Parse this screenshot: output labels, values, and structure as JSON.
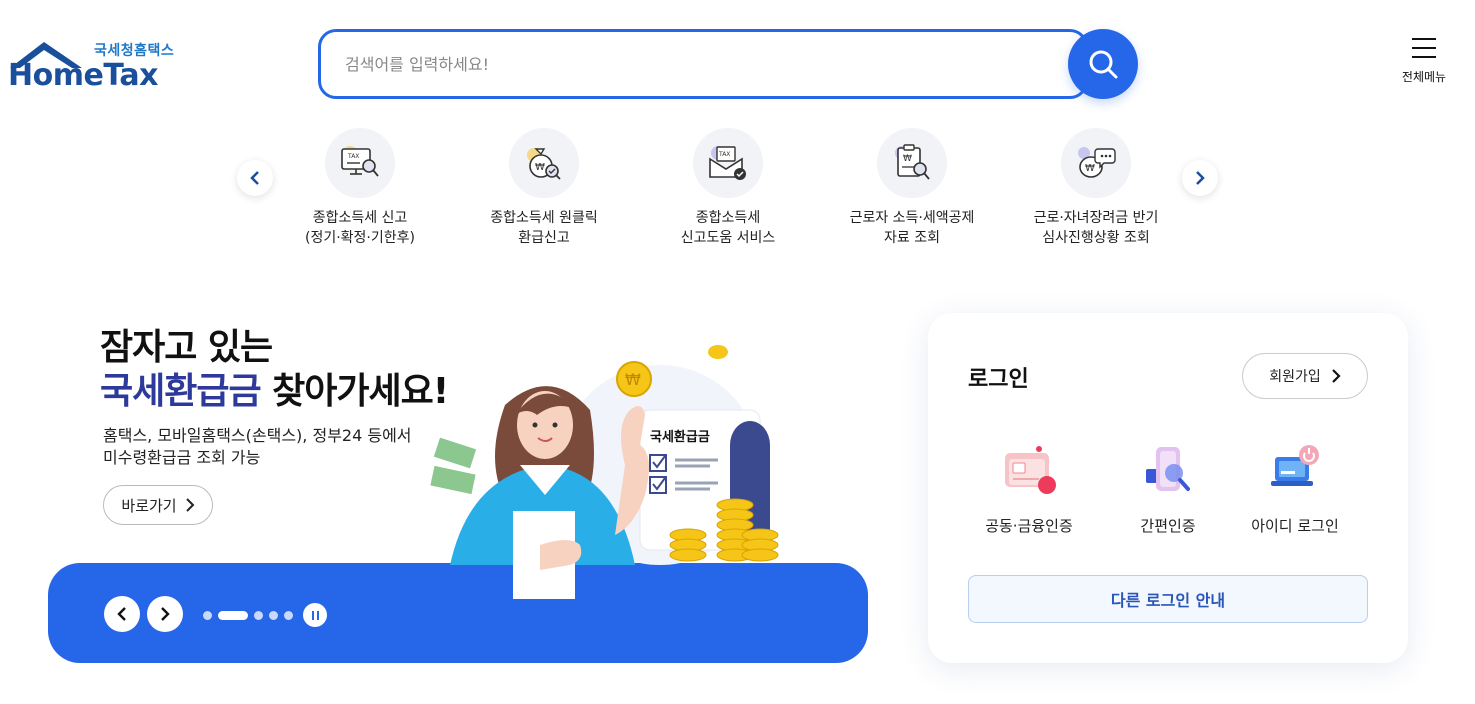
{
  "header": {
    "logo_ko": "국세청홈택스",
    "logo_en": "HomeTax",
    "search_placeholder": "검색어를 입력하세요!",
    "search_icon": "search-icon",
    "menu_label": "전체메뉴",
    "menu_icon": "hamburger-icon"
  },
  "services": [
    {
      "line1": "종합소득세 신고",
      "line2": "(정기·확정·기한후)",
      "icon": "tax-monitor-icon"
    },
    {
      "line1": "종합소득세 원클릭",
      "line2": "환급신고",
      "icon": "money-bag-check-icon"
    },
    {
      "line1": "종합소득세",
      "line2": "신고도움 서비스",
      "icon": "tax-mail-icon"
    },
    {
      "line1": "근로자 소득·세액공제",
      "line2": "자료 조회",
      "icon": "receipt-search-icon"
    },
    {
      "line1": "근로·자녀장려금 반기",
      "line2": "심사진행상황 조회",
      "icon": "money-chat-icon"
    }
  ],
  "banner": {
    "headline_1": "잠자고 있는",
    "headline_2_highlight": "국세환급금",
    "headline_2_rest": " 찾아가세요!",
    "desc_1": "홈택스, 모바일홈택스(손택스), 정부24 등에서",
    "desc_2": "미수령환급금 조회 가능",
    "go_button": "바로가기",
    "doc_label": "국세환급금",
    "slide_count": 5,
    "active_slide": 2
  },
  "login": {
    "title": "로그인",
    "join_button": "회원가입",
    "options": [
      {
        "label": "공동·금융인증",
        "icon": "certificate-card-icon"
      },
      {
        "label": "간편인증",
        "icon": "phone-search-icon"
      },
      {
        "label": "아이디 로그인",
        "icon": "laptop-power-icon"
      }
    ],
    "other_button": "다른 로그인 안내"
  },
  "colors": {
    "primary": "#2567e8",
    "navy": "#1a4f9c",
    "highlight": "#2d3a9b"
  }
}
